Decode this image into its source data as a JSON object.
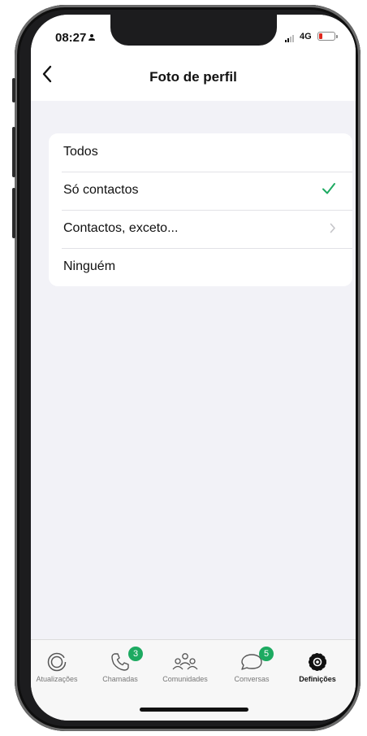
{
  "status_bar": {
    "time": "08:27",
    "network": "4G",
    "battery_color": "#e0281e"
  },
  "header": {
    "back_icon": "chevron-left-icon",
    "title": "Foto de perfil"
  },
  "options": [
    {
      "label": "Todos",
      "selected": false
    },
    {
      "label": "Só contactos",
      "selected": true,
      "indicator": "checkmark-icon"
    },
    {
      "label": "Contactos, exceto...",
      "selected": false,
      "indicator": "chevron-right-icon"
    },
    {
      "label": "Ninguém",
      "selected": false
    }
  ],
  "tabbar": {
    "tabs": [
      {
        "label": "Atualizações",
        "icon": "status-icon",
        "active": false
      },
      {
        "label": "Chamadas",
        "icon": "phone-icon",
        "active": false,
        "badge": "3"
      },
      {
        "label": "Comunidades",
        "icon": "communities-icon",
        "active": false
      },
      {
        "label": "Conversas",
        "icon": "chat-bubble-icon",
        "active": false,
        "badge": "5"
      },
      {
        "label": "Definições",
        "icon": "gear-icon",
        "active": true
      }
    ]
  },
  "colors": {
    "accent": "#1daa61",
    "badge": "#1daa61",
    "background": "#f2f2f7"
  }
}
